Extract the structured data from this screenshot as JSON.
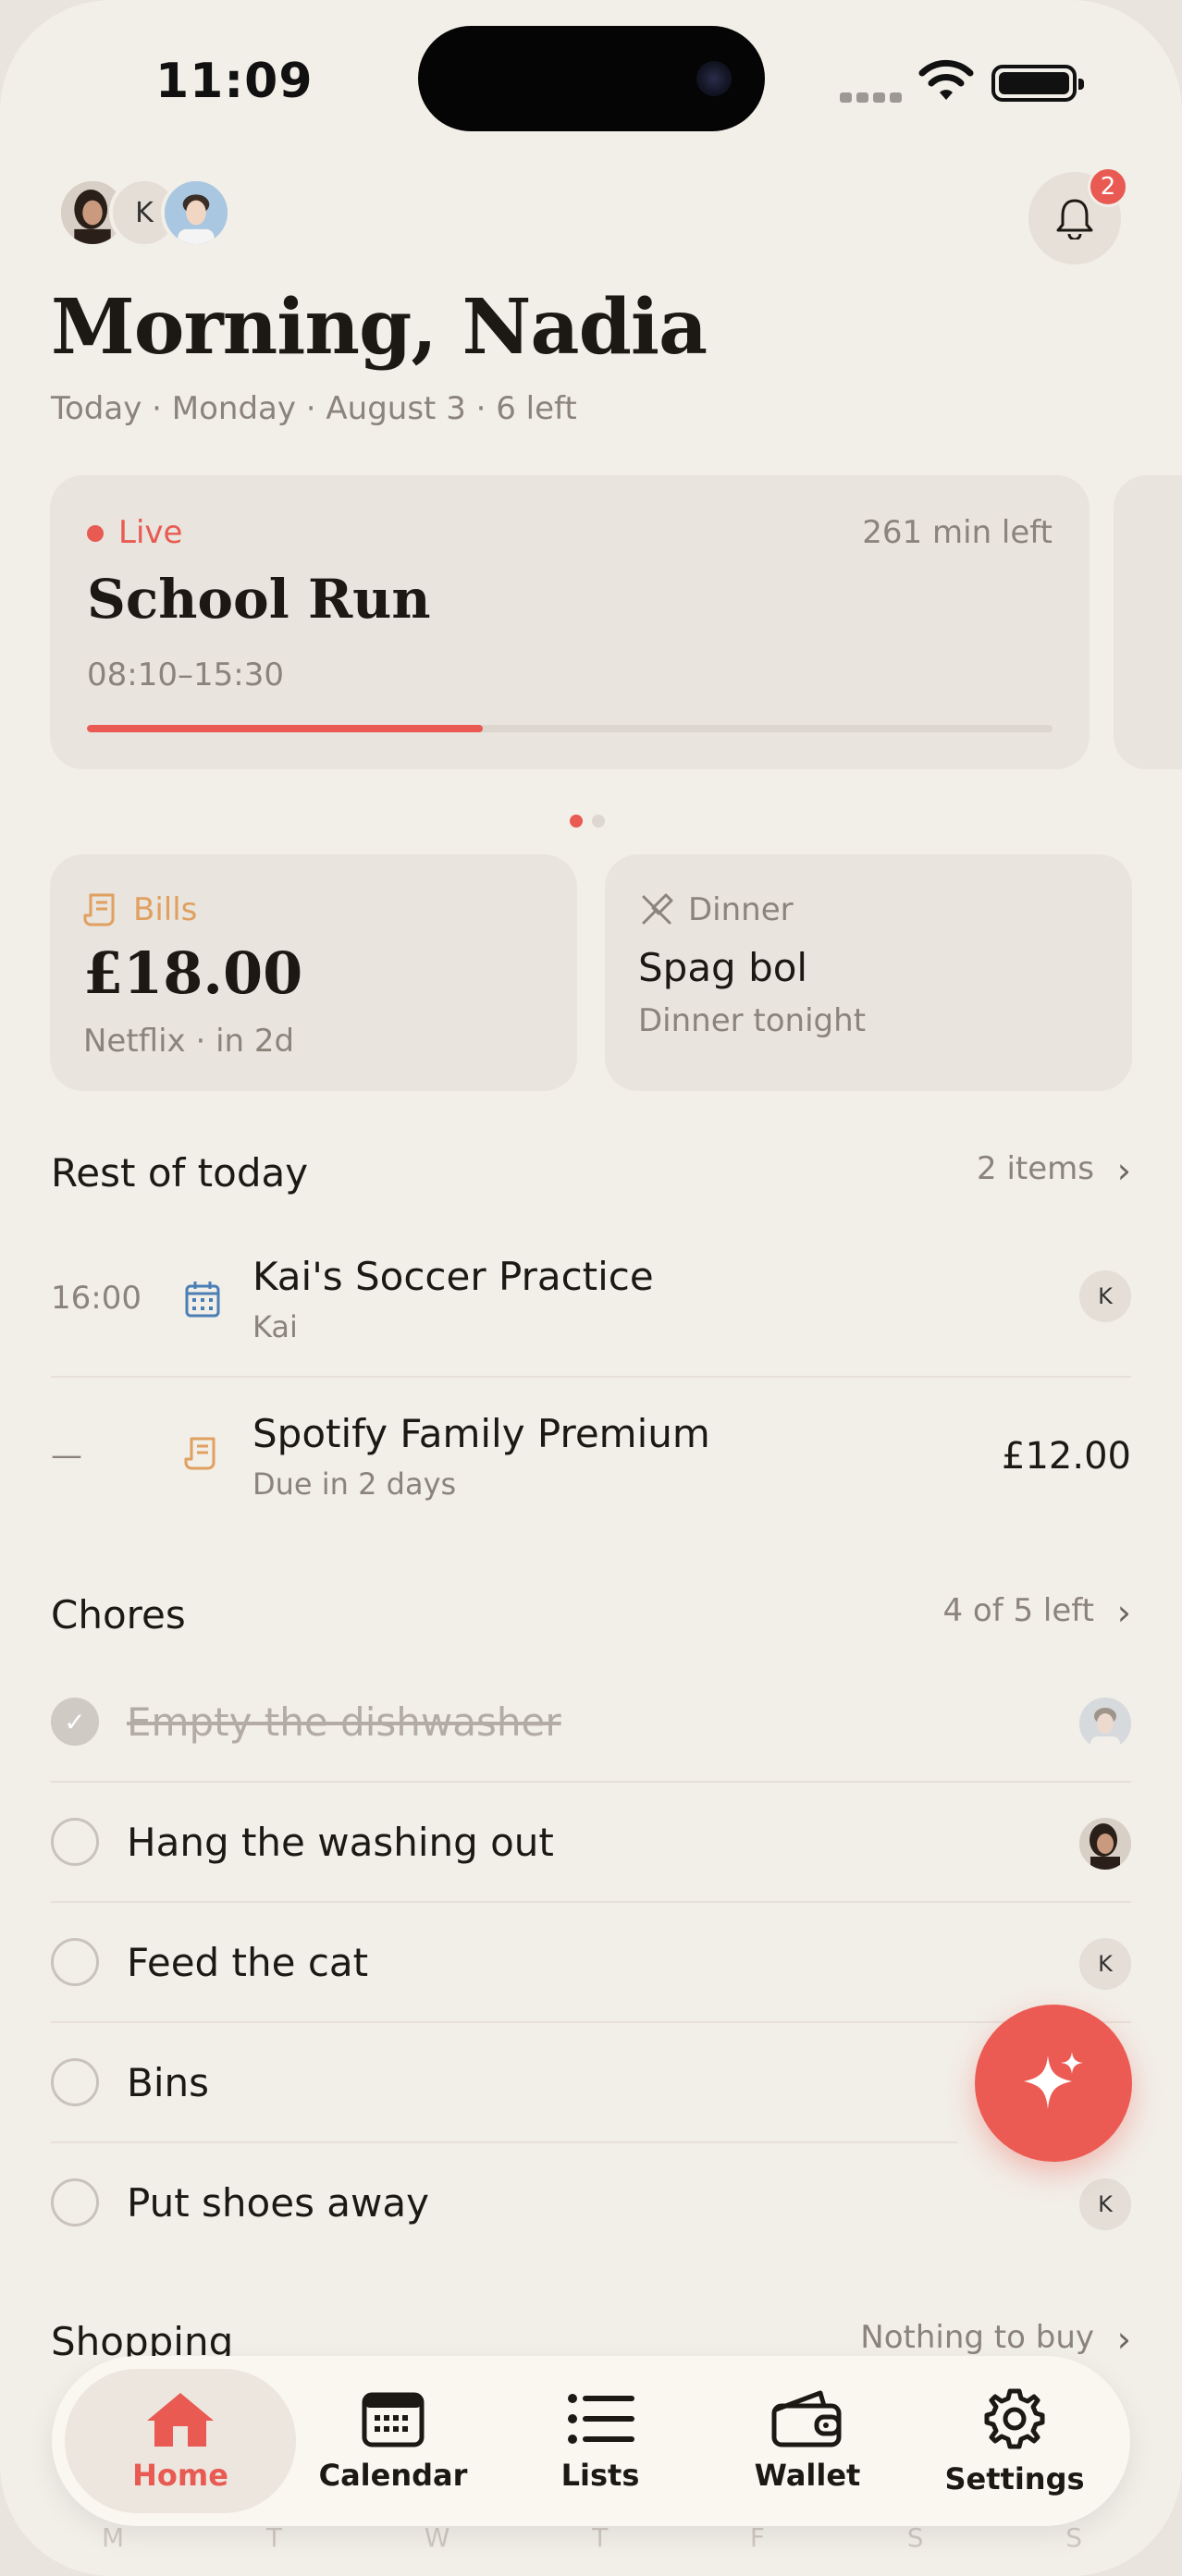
{
  "status_bar": {
    "time": "11:09"
  },
  "header": {
    "avatar_initial": "K",
    "notification_count": "2",
    "greeting": "Morning, Nadia",
    "date_line": "Today · Monday · August 3 · 6 left"
  },
  "live_card": {
    "status": "Live",
    "time_left": "261 min left",
    "title": "School Run",
    "time_range": "08:10–15:30",
    "progress_fraction": 0.41
  },
  "bills_card": {
    "label": "Bills",
    "amount": "£18.00",
    "sub": "Netflix · in 2d"
  },
  "dinner_card": {
    "label": "Dinner",
    "title": "Spag bol",
    "sub": "Dinner tonight"
  },
  "rest_of_today": {
    "title": "Rest of today",
    "meta": "2 items",
    "items": [
      {
        "time": "16:00",
        "title": "Kai's Soccer Practice",
        "sub": "Kai",
        "chip": "K",
        "icon": "calendar-icon"
      },
      {
        "time": "—",
        "title": "Spotify Family Premium",
        "sub": "Due in 2 days",
        "amount": "£12.00",
        "icon": "receipt-icon"
      }
    ]
  },
  "chores": {
    "title": "Chores",
    "meta": "4 of 5 left",
    "items": [
      {
        "label": "Empty the dishwasher",
        "done": true,
        "assignee": "photo"
      },
      {
        "label": "Hang the washing out",
        "done": false,
        "assignee": "photo"
      },
      {
        "label": "Feed the cat",
        "done": false,
        "assignee": "K"
      },
      {
        "label": "Bins",
        "done": false,
        "assignee": ""
      },
      {
        "label": "Put shoes away",
        "done": false,
        "assignee": "K"
      }
    ]
  },
  "shopping": {
    "title": "Shopping",
    "meta": "Nothing to buy"
  },
  "weekdays": [
    "M",
    "T",
    "W",
    "T",
    "F",
    "S",
    "S"
  ],
  "tabbar": {
    "home": "Home",
    "calendar": "Calendar",
    "lists": "Lists",
    "wallet": "Wallet",
    "settings": "Settings"
  },
  "colors": {
    "accent": "#e85a52",
    "bills": "#e0a060",
    "calendar": "#4a7fb5",
    "background": "#f2eee8",
    "card": "#e9e4dd"
  }
}
